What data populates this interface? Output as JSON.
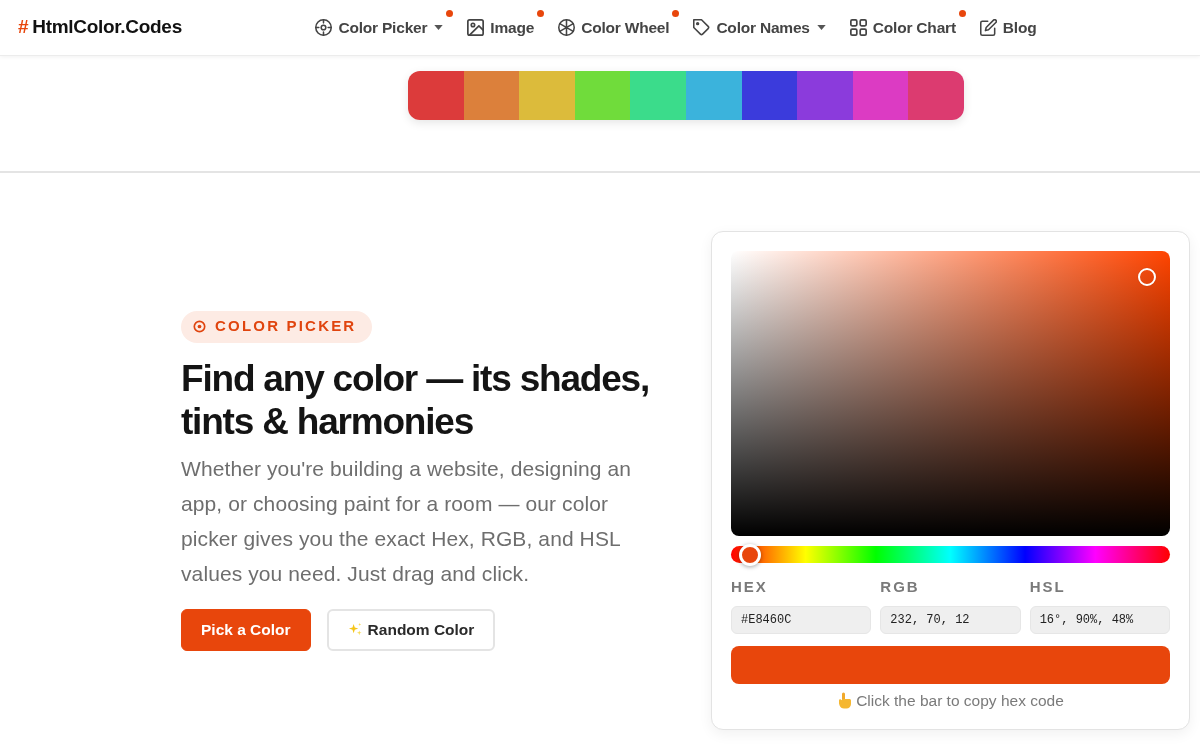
{
  "logo": {
    "mark": "#",
    "text": "HtmlColor.Codes"
  },
  "nav": [
    {
      "label": "Color Picker",
      "dropdown": true,
      "dot": true
    },
    {
      "label": "Image",
      "dropdown": false,
      "dot": true
    },
    {
      "label": "Color Wheel",
      "dropdown": false,
      "dot": true
    },
    {
      "label": "Color Names",
      "dropdown": true,
      "dot": false
    },
    {
      "label": "Color Chart",
      "dropdown": false,
      "dot": true
    },
    {
      "label": "Blog",
      "dropdown": false,
      "dot": false
    }
  ],
  "swatches": [
    {
      "color": "#dc3b3b"
    },
    {
      "color": "#dc803b"
    },
    {
      "color": "#dcbb3b"
    },
    {
      "color": "#70dc3b"
    },
    {
      "color": "#3bdc8b"
    },
    {
      "color": "#3bb3dc"
    },
    {
      "color": "#3b3bdc"
    },
    {
      "color": "#8b3bdc"
    },
    {
      "color": "#dc3bc3"
    },
    {
      "color": "#dc3b70"
    }
  ],
  "hero": {
    "badge": "COLOR PICKER",
    "title": "Find any color — its shades, tints & harmonies",
    "text": "Whether you're building a website, designing an app, or choosing paint for a room — our color picker gives you the exact Hex, RGB, and HSL values you need. Just drag and click.",
    "buttons": [
      {
        "label": "Pick a Color",
        "kind": "primary"
      },
      {
        "label": "Random Color",
        "kind": "outline"
      }
    ]
  },
  "picker": {
    "hue_slider": {
      "level": 0.044
    },
    "fields": [
      {
        "label": "HEX",
        "value": "#E8460C"
      },
      {
        "label": "RGB",
        "value": "232, 70, 12"
      },
      {
        "label": "HSL",
        "value": "16°, 90%, 48%"
      }
    ],
    "hint": "Click the bar to copy hex code"
  }
}
